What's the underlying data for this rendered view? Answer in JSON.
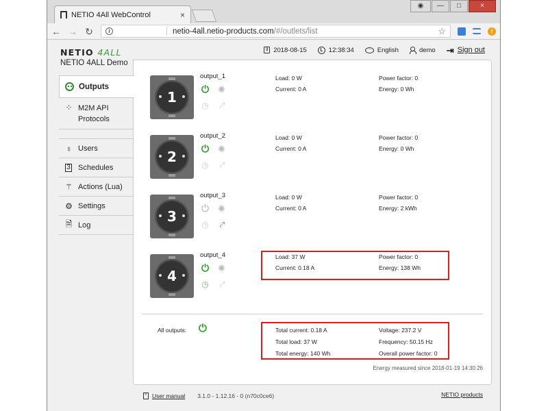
{
  "browser": {
    "tab_title": "NETIO 4All WebControl",
    "tab_close": "×",
    "url_host": "netio-4all.netio-products.com",
    "url_path": "/#/outlets/list",
    "window_min": "—",
    "window_max": "□",
    "window_close": "×"
  },
  "header": {
    "logo_main": "NETIO",
    "logo_accent": "4ALL",
    "device_name": "NETIO 4ALL Demo",
    "date": "2018-08-15",
    "time": "12:38:34",
    "language": "English",
    "user": "demo",
    "signout": "Sign out"
  },
  "sidebar": {
    "items": [
      {
        "label": "Outputs",
        "icon": "outlet-icon"
      },
      {
        "label": "M2M API Protocols",
        "icon": "m2m-icon"
      },
      {
        "label": "Users",
        "icon": "user-icon"
      },
      {
        "label": "Schedules",
        "icon": "calendar-icon"
      },
      {
        "label": "Actions (Lua)",
        "icon": "wand-icon"
      },
      {
        "label": "Settings",
        "icon": "gear-icon"
      },
      {
        "label": "Log",
        "icon": "document-icon"
      }
    ]
  },
  "outlets": [
    {
      "number": "1",
      "name": "output_1",
      "load": "Load: 0 W",
      "current": "Current: 0 A",
      "power_factor": "Power factor: 0",
      "energy": "Energy: 0 Wh",
      "state": "on",
      "scheduled": false,
      "action_running": false
    },
    {
      "number": "2",
      "name": "output_2",
      "load": "Load: 0 W",
      "current": "Current: 0 A",
      "power_factor": "Power factor: 0",
      "energy": "Energy: 0 Wh",
      "state": "on",
      "scheduled": false,
      "action_running": false
    },
    {
      "number": "3",
      "name": "output_3",
      "load": "Load: 0 W",
      "current": "Current: 0 A",
      "power_factor": "Power factor: 0",
      "energy": "Energy: 2 kWh",
      "state": "off",
      "scheduled": false,
      "action_running": true
    },
    {
      "number": "4",
      "name": "output_4",
      "load": "Load: 37 W",
      "current": "Current: 0.18 A",
      "power_factor": "Power factor: 0",
      "energy": "Energy: 138 Wh",
      "state": "on",
      "scheduled": true,
      "action_running": false
    }
  ],
  "all_outputs": {
    "label": "All outputs:",
    "total_current": "Total current: 0.18 A",
    "total_load": "Total load: 37 W",
    "total_energy": "Total energy: 140 Wh",
    "voltage": "Voltage: 237.2 V",
    "frequency": "Frequency: 50.15 Hz",
    "overall_pf": "Overall power factor: 0",
    "energy_since": "Energy measured since 2018-01-19 14:30:26"
  },
  "footer": {
    "manual": "User manual",
    "version": "3.1.0 - 1.12.16 - 0 (n70c0ce6)",
    "products": "NETIO products"
  },
  "colors": {
    "accent_green": "#2e9e2e",
    "highlight_red": "#e21c1c"
  }
}
